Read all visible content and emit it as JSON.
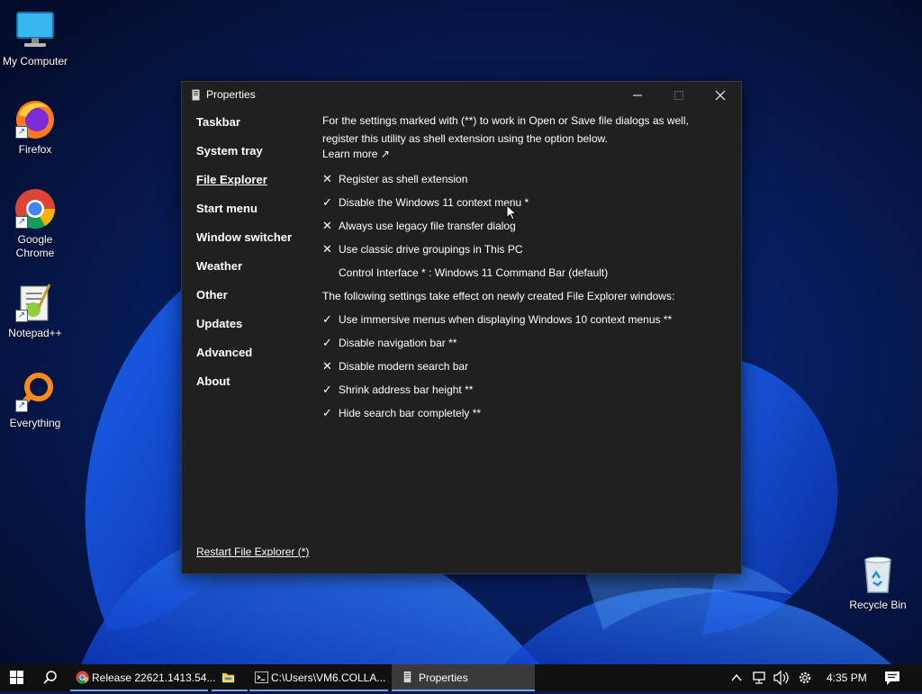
{
  "desktop": {
    "icons": [
      {
        "label": "My Computer"
      },
      {
        "label": "Firefox"
      },
      {
        "label": "Google Chrome"
      },
      {
        "label": "Notepad++"
      },
      {
        "label": "Everything"
      },
      {
        "label": "Recycle Bin"
      }
    ]
  },
  "window": {
    "title": "Properties",
    "sidebar": [
      {
        "label": "Taskbar"
      },
      {
        "label": "System tray"
      },
      {
        "label": "File Explorer",
        "active": true
      },
      {
        "label": "Start menu"
      },
      {
        "label": "Window switcher"
      },
      {
        "label": "Weather"
      },
      {
        "label": "Other"
      },
      {
        "label": "Updates"
      },
      {
        "label": "Advanced"
      },
      {
        "label": "About"
      }
    ],
    "intro": "For the settings marked with (**) to work in Open or Save file dialogs as well, register this utility as shell extension using the option below.",
    "learn_more": "Learn more ↗",
    "options": [
      {
        "mark": "✕",
        "label": "Register as shell extension"
      },
      {
        "mark": "✓",
        "label": "Disable the Windows 11 context menu *"
      },
      {
        "mark": "✕",
        "label": "Always use legacy file transfer dialog"
      },
      {
        "mark": "✕",
        "label": "Use classic drive groupings in This PC"
      }
    ],
    "control_interface": "Control Interface * : Windows 11 Command Bar (default)",
    "section_note": "The following settings take effect on newly created File Explorer windows:",
    "options2": [
      {
        "mark": "✓",
        "label": "Use immersive menus when displaying Windows 10 context menus **"
      },
      {
        "mark": "✓",
        "label": "Disable navigation bar **"
      },
      {
        "mark": "✕",
        "label": "Disable modern search bar"
      },
      {
        "mark": "✓",
        "label": "Shrink address bar height **"
      },
      {
        "mark": "✓",
        "label": "Hide search bar completely **"
      }
    ],
    "restart_link": "Restart File Explorer (*)"
  },
  "taskbar": {
    "apps": [
      {
        "label": "Release 22621.1413.54..."
      },
      {
        "label": ""
      },
      {
        "label": "C:\\Users\\VM6.COLLA..."
      },
      {
        "label": "Properties"
      }
    ],
    "clock": "4:35 PM"
  },
  "colors": {
    "window_bg": "#202020",
    "taskbar_bg": "#101010",
    "accent": "#77a6e8"
  }
}
